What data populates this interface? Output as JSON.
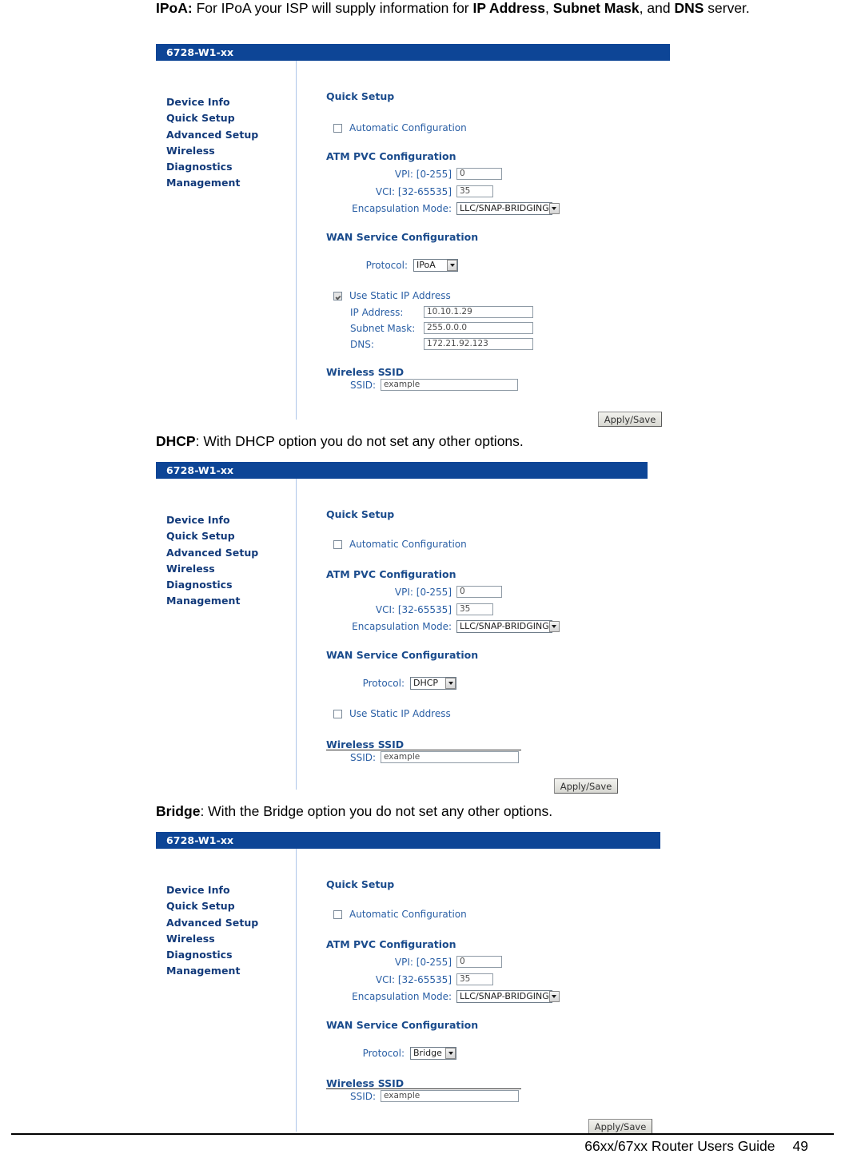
{
  "document": {
    "footer_guide": "66xx/67xx Router Users Guide",
    "footer_page": "49"
  },
  "paragraphs": {
    "ipoa_lead": "IPoA:",
    "ipoa_text_1": " For IPoA your ISP will supply information for ",
    "ipoa_bold_1": "IP Address",
    "ipoa_text_2": ", ",
    "ipoa_bold_2": "Subnet Mask",
    "ipoa_text_3": ", and ",
    "ipoa_bold_3": "DNS",
    "ipoa_text_4": " server.",
    "dhcp_lead": "DHCP",
    "dhcp_text": ": With DHCP option you do not set any other options.",
    "bridge_lead": "Bridge",
    "bridge_text": ": With the Bridge option you do not set any other options."
  },
  "router": {
    "title": "6728-W1-xx",
    "nav": [
      "Device Info",
      "Quick Setup",
      "Advanced Setup",
      "Wireless",
      "Diagnostics",
      "Management"
    ],
    "headings": {
      "quick_setup": "Quick Setup",
      "atm_pvc": "ATM PVC Configuration",
      "wan_service": "WAN Service Configuration",
      "wireless_ssid": "Wireless SSID"
    },
    "labels": {
      "automatic_configuration": "Automatic Configuration",
      "vpi": "VPI: [0-255]",
      "vci": "VCI: [32-65535]",
      "encapsulation_mode": "Encapsulation Mode:",
      "protocol": "Protocol:",
      "use_static_ip": "Use Static IP Address",
      "ip_address": "IP Address:",
      "subnet_mask": "Subnet Mask:",
      "dns": "DNS:",
      "ssid": "SSID:"
    },
    "apply_save": "Apply/Save",
    "values": {
      "vpi": "0",
      "vci": "35",
      "encapsulation_mode": "LLC/SNAP-BRIDGING",
      "ssid": "example"
    }
  },
  "panels": [
    {
      "id": "ipoa",
      "protocol": "IPoA",
      "automatic_configuration_checked": false,
      "use_static_ip_checked": true,
      "static": {
        "ip_address": "10.10.1.29",
        "subnet_mask": "255.0.0.0",
        "dns": "172.21.92.123"
      }
    },
    {
      "id": "dhcp",
      "protocol": "DHCP",
      "automatic_configuration_checked": false,
      "use_static_ip_checked": false
    },
    {
      "id": "bridge",
      "protocol": "Bridge",
      "automatic_configuration_checked": false,
      "use_static_ip_checked": false
    }
  ],
  "colors": {
    "titlebar_blue": "#0d4596",
    "nav_blue": "#123a7a",
    "heading_blue": "#1a4b8c",
    "label_blue": "#2a5fa5",
    "divider_blue": "#aec6e8"
  }
}
